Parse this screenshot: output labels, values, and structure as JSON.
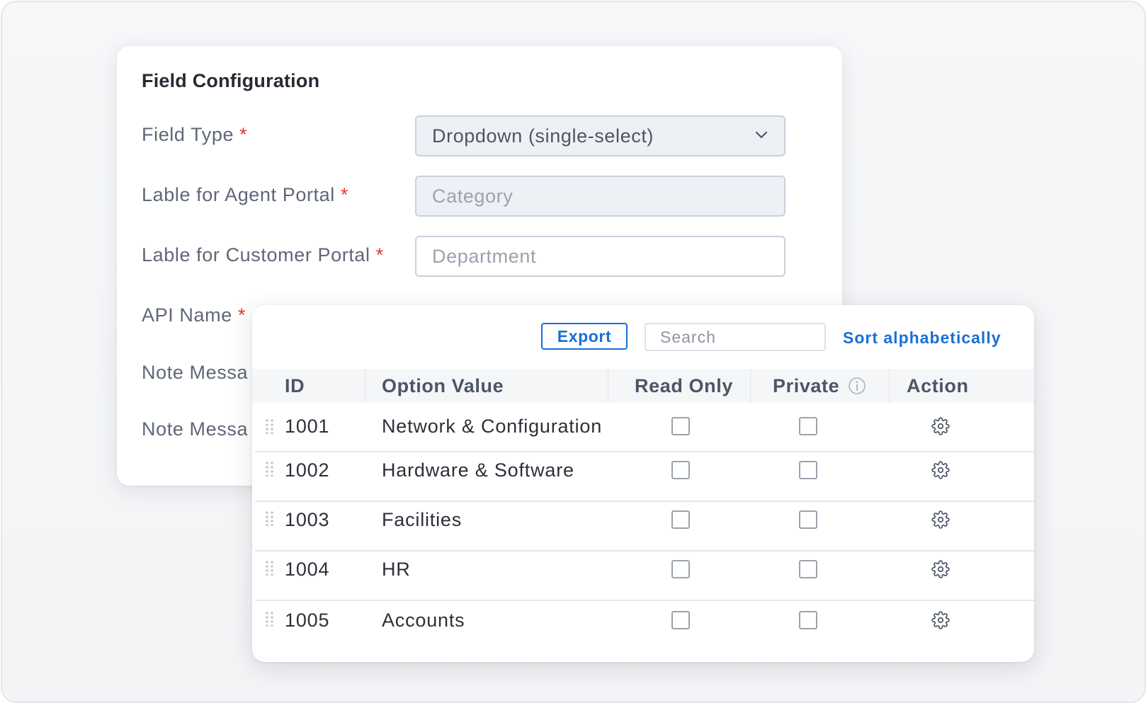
{
  "field_config": {
    "title": "Field Configuration",
    "required_marker": "*",
    "fields": [
      {
        "label": "Field Type",
        "value": "Dropdown (single-select)",
        "icon": "chevron-down-icon"
      },
      {
        "label": "Lable for Agent Portal",
        "placeholder": "Category"
      },
      {
        "label": "Lable for Customer Portal",
        "placeholder": "Department"
      },
      {
        "label": "API Name"
      },
      {
        "label": "Note Messa"
      },
      {
        "label": "Note Messa"
      }
    ]
  },
  "options_panel": {
    "toolbar": {
      "export_label": "Export",
      "search_placeholder": "Search",
      "sort_label": "Sort alphabetically"
    },
    "columns": {
      "id": "ID",
      "option_value": "Option Value",
      "read_only": "Read Only",
      "private": "Private",
      "action": "Action"
    },
    "rows": [
      {
        "id": "1001",
        "value": "Network & Configuration",
        "read_only": false,
        "private": false
      },
      {
        "id": "1002",
        "value": "Hardware & Software",
        "read_only": false,
        "private": false
      },
      {
        "id": "1003",
        "value": "Facilities",
        "read_only": false,
        "private": false
      },
      {
        "id": "1004",
        "value": "HR",
        "read_only": false,
        "private": false
      },
      {
        "id": "1005",
        "value": "Accounts",
        "read_only": false,
        "private": false
      }
    ],
    "icons": {
      "drag": "drag-handle-icon",
      "info": "info-icon",
      "action": "gear-icon"
    }
  },
  "colors": {
    "accent": "#1a6fd6",
    "required": "#e0392e"
  }
}
